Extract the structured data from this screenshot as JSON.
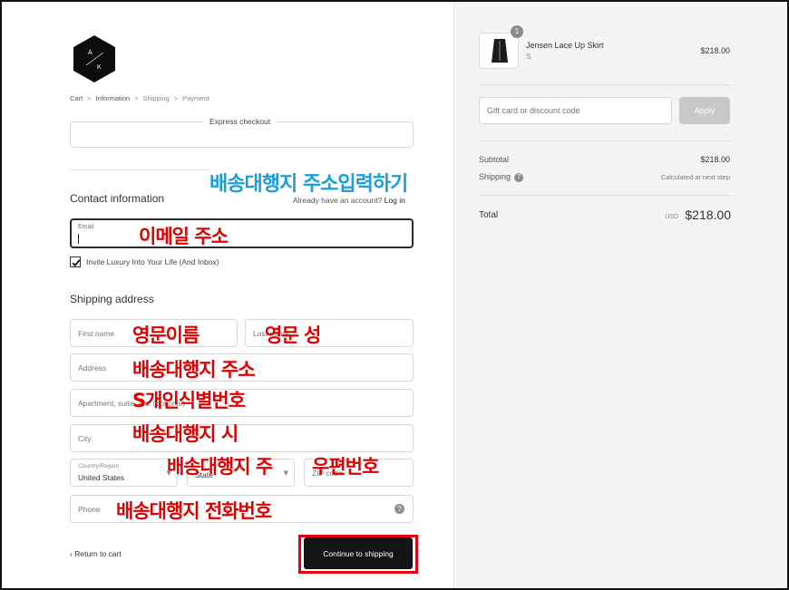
{
  "logo": {
    "letters": [
      "A",
      "K"
    ]
  },
  "breadcrumb": [
    "Cart",
    "Information",
    "Shipping",
    "Payment"
  ],
  "express_checkout": {
    "title": "Express checkout"
  },
  "contact": {
    "title": "Contact information",
    "have_account_text": "Already have an account?",
    "login_link": "Log in",
    "email_label": "Email",
    "email_value": "",
    "newsletter_label": "Invite Luxury Into Your Life (And Inbox)",
    "newsletter_checked": true
  },
  "shipping": {
    "title": "Shipping address",
    "first_name": "First name",
    "last_name": "Last name",
    "address": "Address",
    "apartment": "Apartment, suite, etc. (optional)",
    "city": "City",
    "country_label": "Country/Region",
    "country_value": "United States",
    "state": "State",
    "zip": "ZIP code",
    "phone": "Phone"
  },
  "footer": {
    "return_link": "Return to cart",
    "continue_button": "Continue to shipping"
  },
  "order": {
    "quantity": "1",
    "product_name": "Jensen Lace Up Skirt",
    "variant": "S",
    "price": "$218.00",
    "gift_placeholder": "Gift card or discount code",
    "apply_label": "Apply",
    "subtotal_label": "Subtotal",
    "subtotal_value": "$218.00",
    "shipping_label": "Shipping",
    "shipping_value": "Calculated at next step",
    "total_label": "Total",
    "total_currency": "USD",
    "total_value": "$218.00"
  },
  "annotations": {
    "heading": "배송대행지 주소입력하기",
    "email": "이메일 주소",
    "first_name": "영문이름",
    "last_name": "영문 성",
    "address": "배송대행지 주소",
    "apartment": "S개인식별번호",
    "city": "배송대행지 시",
    "state": "배송대행지 주",
    "zip": "우편번호",
    "phone": "배송대행지 전화번호"
  },
  "colors": {
    "annotation_red": "#e00000",
    "annotation_blue": "#1a9fd8",
    "button_dark": "#141414",
    "highlight_border": "#e0000f"
  }
}
